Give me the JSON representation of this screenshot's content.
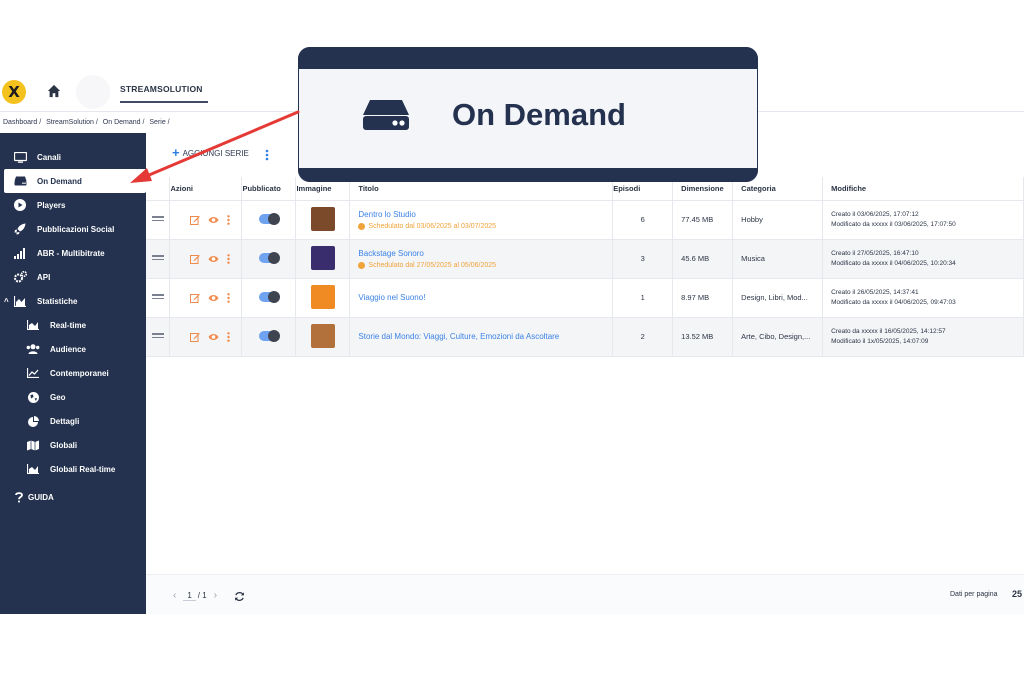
{
  "topbar": {
    "logo_letter": "X",
    "tab_label": "STREAMSOLUTION"
  },
  "breadcrumb": [
    "Dashboard /",
    "StreamSolution /",
    "On Demand /",
    "Serie /"
  ],
  "sidebar": {
    "items": [
      {
        "label": "Canali",
        "icon": "monitor-icon"
      },
      {
        "label": "On Demand",
        "icon": "hdd-icon",
        "active": true
      },
      {
        "label": "Players",
        "icon": "play-icon"
      },
      {
        "label": "Pubblicazioni Social",
        "icon": "rocket-icon"
      },
      {
        "label": "ABR - Multibitrate",
        "icon": "signal-icon"
      },
      {
        "label": "API",
        "icon": "cogs-icon"
      },
      {
        "label": "Statistiche",
        "icon": "chart-area-icon",
        "caret": "^"
      },
      {
        "label": "Real-time",
        "icon": "area-chart-icon"
      },
      {
        "label": "Audience",
        "icon": "users-icon"
      },
      {
        "label": "Contemporanei",
        "icon": "line-chart-icon"
      },
      {
        "label": "Geo",
        "icon": "globe-icon"
      },
      {
        "label": "Dettagli",
        "icon": "pie-chart-icon"
      },
      {
        "label": "Globali",
        "icon": "map-icon"
      },
      {
        "label": "Globali Real-time",
        "icon": "area-chart-icon"
      }
    ],
    "guide_label": "GUIDA"
  },
  "toolbar": {
    "add_series_label": "AGGIUNGI SERIE"
  },
  "table": {
    "headers": {
      "azioni": "Azioni",
      "pubblicato": "Pubblicato",
      "immagine": "Immagine",
      "titolo": "Titolo",
      "episodi": "Episodi",
      "dimensione": "Dimensione",
      "categoria": "Categoria",
      "modifiche": "Modifiche"
    },
    "rows": [
      {
        "title": "Dentro lo Studio",
        "schedule": "Schedulato dal 03/06/2025 al 03/07/2025",
        "episodes": "6",
        "size": "77.45 MB",
        "category": "Hobby",
        "created": "Creato il 03/06/2025, 17:07:12",
        "modified": "Modificato da xxxxx il 03/06/2025, 17:07:50",
        "thumb_color": "#7a4a2a",
        "published": true
      },
      {
        "title": "Backstage Sonoro",
        "schedule": "Schedulato dal 27/05/2025 al 05/06/2025",
        "episodes": "3",
        "size": "45.6 MB",
        "category": "Musica",
        "created": "Creato il 27/05/2025, 16:47:10",
        "modified": "Modificato da xxxxx il 04/06/2025, 10:20:34",
        "thumb_color": "#3a2d6e",
        "published": true
      },
      {
        "title": "Viaggio nel Suono!",
        "schedule": "",
        "episodes": "1",
        "size": "8.97 MB",
        "category": "Design, Libri, Mod...",
        "created": "Creato il 26/05/2025, 14:37:41",
        "modified": "Modificato da xxxxx il 04/06/2025, 09:47:03",
        "thumb_color": "#f08a22",
        "published": true
      },
      {
        "title": "Storie dal Mondo: Viaggi, Culture, Emozioni da Ascoltare",
        "schedule": "",
        "episodes": "2",
        "size": "13.52 MB",
        "category": "Arte, Cibo, Design,...",
        "created": "Creato da xxxxx il 16/05/2025, 14:12:57",
        "modified": "Modificato il 1x/05/2025, 14:07:09",
        "thumb_color": "#b2713a",
        "published": true
      }
    ]
  },
  "pagination": {
    "current_page": "1",
    "total": "/ 1",
    "per_page_label": "Dati per pagina",
    "per_page_value": "25"
  },
  "callout": {
    "title": "On Demand",
    "icon": "hdd-icon"
  },
  "colors": {
    "sidebar_bg": "#24324f",
    "link": "#3b82e6",
    "warning": "#f0a33a",
    "action_orange": "#f08a4a",
    "arrow_red": "#e53935"
  }
}
